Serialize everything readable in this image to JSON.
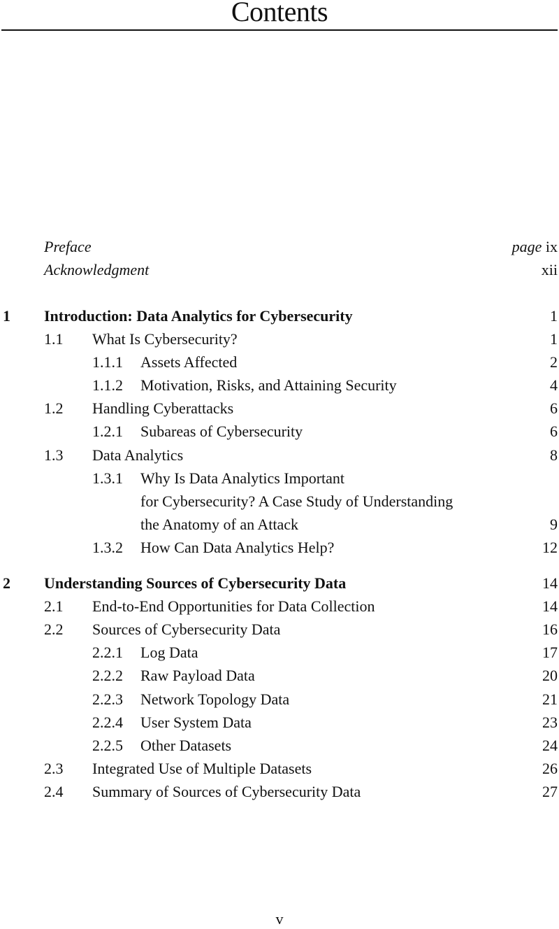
{
  "page": {
    "title": "Contents",
    "folio": "v"
  },
  "front_matter": [
    {
      "title": "Preface",
      "page_prefix": "page",
      "page": "ix"
    },
    {
      "title": "Acknowledgment",
      "page": "xii"
    }
  ],
  "chapters": [
    {
      "number": "1",
      "title": "Introduction: Data Analytics for Cybersecurity",
      "page": "1",
      "sections": [
        {
          "number": "1.1",
          "title": "What Is Cybersecurity?",
          "page": "1"
        },
        {
          "number": "1.1.1",
          "title": "Assets Affected",
          "page": "2"
        },
        {
          "number": "1.1.2",
          "title": "Motivation, Risks, and Attaining Security",
          "page": "4"
        },
        {
          "number": "1.2",
          "title": "Handling Cyberattacks",
          "page": "6"
        },
        {
          "number": "1.2.1",
          "title": "Subareas of Cybersecurity",
          "page": "6"
        },
        {
          "number": "1.3",
          "title": "Data Analytics",
          "page": "8"
        },
        {
          "number": "1.3.1",
          "title_lines": [
            "Why Is Data Analytics Important",
            "for Cybersecurity? A Case Study of Understanding",
            "the Anatomy of an Attack"
          ],
          "page": "9"
        },
        {
          "number": "1.3.2",
          "title": "How Can Data Analytics Help?",
          "page": "12"
        }
      ]
    },
    {
      "number": "2",
      "title": "Understanding Sources of Cybersecurity Data",
      "page": "14",
      "sections": [
        {
          "number": "2.1",
          "title": "End-to-End Opportunities for Data Collection",
          "page": "14"
        },
        {
          "number": "2.2",
          "title": "Sources of Cybersecurity Data",
          "page": "16"
        },
        {
          "number": "2.2.1",
          "title": "Log Data",
          "page": "17"
        },
        {
          "number": "2.2.2",
          "title": "Raw Payload Data",
          "page": "20"
        },
        {
          "number": "2.2.3",
          "title": "Network Topology Data",
          "page": "21"
        },
        {
          "number": "2.2.4",
          "title": "User System Data",
          "page": "23"
        },
        {
          "number": "2.2.5",
          "title": "Other Datasets",
          "page": "24"
        },
        {
          "number": "2.3",
          "title": "Integrated Use of Multiple Datasets",
          "page": "26"
        },
        {
          "number": "2.4",
          "title": "Summary of Sources of Cybersecurity Data",
          "page": "27"
        }
      ]
    }
  ]
}
